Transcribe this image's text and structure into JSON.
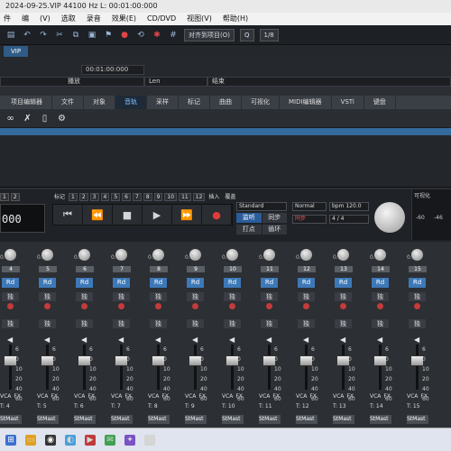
{
  "window": {
    "title": "2024-09-25.VIP   44100 Hz L: 00:01:00:000"
  },
  "menu": {
    "items": [
      "件",
      "编",
      "(V)",
      "选取",
      "录音",
      "效果(E)",
      "CD/DVD",
      "视图(V)",
      "帮助(H)"
    ]
  },
  "toolbar": {
    "snap_label": "对齐到项目(O)",
    "q_label": "Q",
    "division": "1/8"
  },
  "file_tab": {
    "label": "VIP"
  },
  "info": {
    "time_start": "00:01:00:000",
    "play_label": "播放",
    "len_label": "Len",
    "end_label": "结束"
  },
  "panel_tabs": [
    "项目编辑器",
    "文件",
    "对象",
    "音轨",
    "采样",
    "标记",
    "曲曲",
    "可视化",
    "MIDI编辑器",
    "VSTi",
    "键盘"
  ],
  "transport": {
    "time_display": "000",
    "mode": "Standard",
    "monitor": "监听",
    "sync_label": "同步",
    "punch": "打点",
    "loop": "循环",
    "normal": "Normal",
    "bpm": "bpm 120.0",
    "sig": "4 / 4",
    "marker_label": "标记",
    "insert_label": "插入",
    "overdub_label": "覆盖",
    "visual_label": "可视化",
    "small_btns": [
      "1",
      "2"
    ],
    "markers": [
      "1",
      "2",
      "3",
      "4",
      "5",
      "6",
      "7",
      "8",
      "9",
      "10",
      "11",
      "12"
    ]
  },
  "meter": {
    "left": "-60",
    "right": "-46"
  },
  "mixer": {
    "channels": [
      {
        "num": "4",
        "pan": "0.0",
        "track": "T: 4",
        "bus": "StMast"
      },
      {
        "num": "5",
        "pan": "0.0",
        "track": "T: 5",
        "bus": "StMast"
      },
      {
        "num": "6",
        "pan": "0.0",
        "track": "T: 6",
        "bus": "StMast"
      },
      {
        "num": "7",
        "pan": "0.0",
        "track": "T: 7",
        "bus": "StMast"
      },
      {
        "num": "8",
        "pan": "0.0",
        "track": "T: 8",
        "bus": "StMast"
      },
      {
        "num": "9",
        "pan": "0.0",
        "track": "T: 9",
        "bus": "StMast"
      },
      {
        "num": "10",
        "pan": "0.0",
        "track": "T: 10",
        "bus": "StMast"
      },
      {
        "num": "11",
        "pan": "0.0",
        "track": "T: 11",
        "bus": "StMast"
      },
      {
        "num": "12",
        "pan": "0.0",
        "track": "T: 12",
        "bus": "StMast"
      },
      {
        "num": "13",
        "pan": "0.0",
        "track": "T: 13",
        "bus": "StMast"
      },
      {
        "num": "14",
        "pan": "0.0",
        "track": "T: 14",
        "bus": "StMast"
      },
      {
        "num": "15",
        "pan": "0.0",
        "track": "T: 15",
        "bus": "StMast"
      }
    ],
    "rd_label": "Rd",
    "solo_label": "独",
    "mon_label": "独",
    "vca_label": "VCA",
    "fx_label": "FX",
    "scale": [
      "6",
      "0",
      "10",
      "20",
      "40",
      "60"
    ]
  },
  "colors": {
    "accent": "#2f5b86",
    "active_tab": "#7ec0ff",
    "record": "#e13a3a",
    "rd": "#3d79b8"
  }
}
